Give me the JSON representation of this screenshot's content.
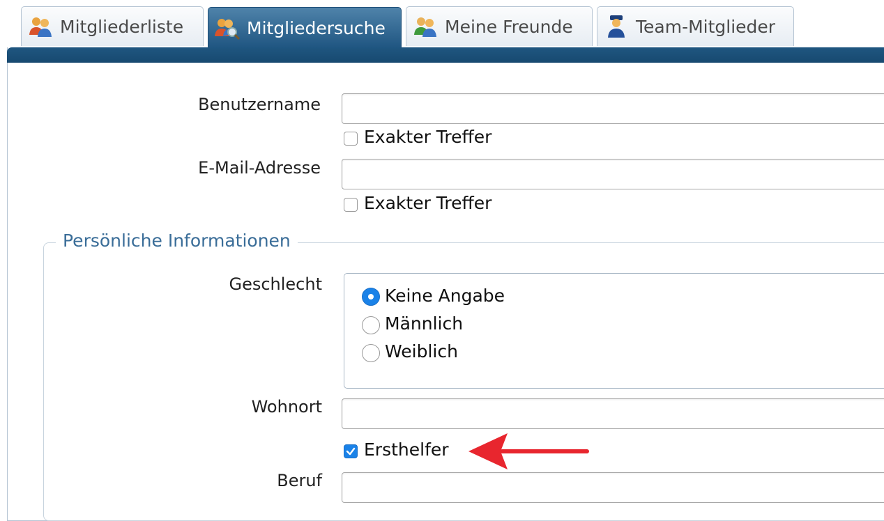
{
  "tabs": [
    {
      "label": "Mitgliederliste",
      "icon": "members-icon",
      "active": false
    },
    {
      "label": "Mitgliedersuche",
      "icon": "member-search-icon",
      "active": true
    },
    {
      "label": "Meine Freunde",
      "icon": "friends-icon",
      "active": false
    },
    {
      "label": "Team-Mitglieder",
      "icon": "team-member-icon",
      "active": false
    }
  ],
  "form": {
    "username_label": "Benutzername",
    "username_value": "",
    "username_exact_label": "Exakter Treffer",
    "email_label": "E-Mail-Adresse",
    "email_value": "",
    "email_exact_label": "Exakter Treffer",
    "personal_legend": "Persönliche Informationen",
    "gender_label": "Geschlecht",
    "gender_options": [
      "Keine Angabe",
      "Männlich",
      "Weiblich"
    ],
    "gender_selected": "Keine Angabe",
    "location_label": "Wohnort",
    "location_value": "",
    "first_aider_label": "Ersthelfer",
    "first_aider_checked": true,
    "job_label": "Beruf",
    "job_value": ""
  },
  "colors": {
    "accent": "#1a82e8",
    "tab_active": "#1f5581",
    "legend": "#3a6d98",
    "annotation_arrow": "#e8262e"
  }
}
